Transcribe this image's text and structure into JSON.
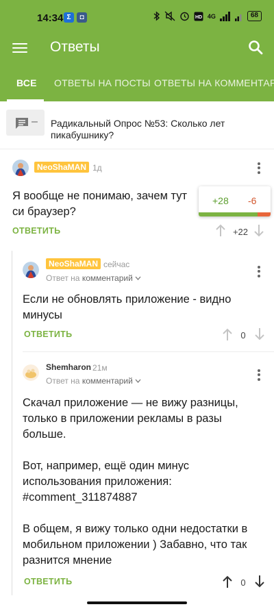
{
  "status_bar": {
    "time": "14:34",
    "notif1": "Σ",
    "notif2": "◘",
    "network": "4G",
    "battery": "68"
  },
  "app_bar": {
    "title": "Ответы"
  },
  "tabs": [
    {
      "label": "ВСЕ",
      "active": true
    },
    {
      "label": "ОТВЕТЫ НА ПОСТЫ",
      "active": false
    },
    {
      "label": "ОТВЕТЫ НА КОММЕНТАРИИ",
      "active": false
    }
  ],
  "post": {
    "title": "Радикальный Опрос №53: Сколько лет пикабушнику?",
    "dash": "–"
  },
  "comments": [
    {
      "author": "NeoShaMAN",
      "time": "1д",
      "text": "Я вообще не понимаю, зачем тут си браузер?",
      "answer_label": "ОТВЕТИТЬ",
      "score": "+22"
    },
    {
      "author": "NeoShaMAN",
      "time": "сейчас",
      "reply_prefix": "Ответ на",
      "reply_target": "комментарий",
      "text": "Если не обновлять приложение - видно минусы",
      "answer_label": "ОТВЕТИТЬ",
      "score": "0"
    },
    {
      "author": "Shemharon",
      "time": "21м",
      "reply_prefix": "Ответ на",
      "reply_target": "комментарий",
      "text_lines": [
        "Скачал приложение — не вижу разницы,",
        "только в приложении рекламы в разы",
        "больше.",
        "",
        "Вот, например, ещё один минус",
        "использования приложения:",
        "#comment_311874887",
        "",
        "В общем, я вижу только одни недостатки в",
        "мобильном приложении ) Забавно, что так",
        "разнится мнение"
      ],
      "answer_label": "ОТВЕТИТЬ",
      "score": "0"
    }
  ],
  "rating_popup": {
    "plus": "+28",
    "minus": "-6",
    "plus_share": 0.82
  },
  "colors": {
    "brand_green": "#7cb342",
    "nick_badge": "#ffc43d",
    "minus_red": "#e8663a"
  }
}
